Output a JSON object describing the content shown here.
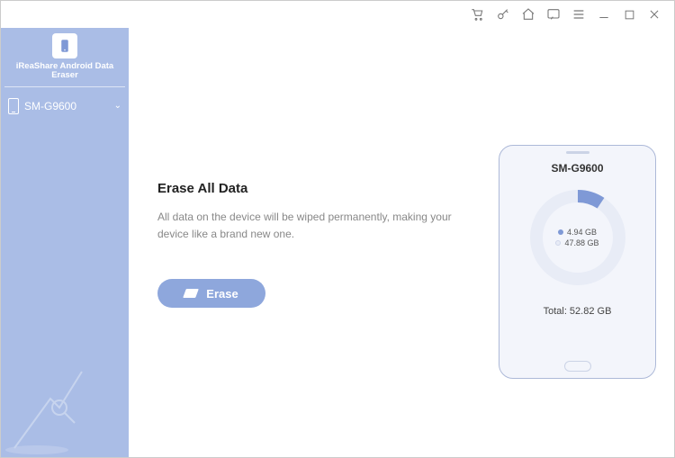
{
  "titlebar": {
    "icons": [
      "cart",
      "key",
      "home",
      "feedback",
      "menu",
      "minimize",
      "maximize",
      "close"
    ]
  },
  "brand": {
    "name": "iReaShare Android Data Eraser"
  },
  "sidebar": {
    "device_label": "SM-G9600"
  },
  "content": {
    "heading": "Erase All Data",
    "description": "All data on the device will be wiped permanently, making your device like a brand new one.",
    "erase_label": "Erase"
  },
  "device": {
    "model": "SM-G9600",
    "used_label": "4.94 GB",
    "free_label": "47.88 GB",
    "total_label": "Total: 52.82 GB",
    "used_gb": 4.94,
    "total_gb": 52.82,
    "colors": {
      "used": "#7f99d6",
      "free": "#e8ecf6"
    }
  }
}
